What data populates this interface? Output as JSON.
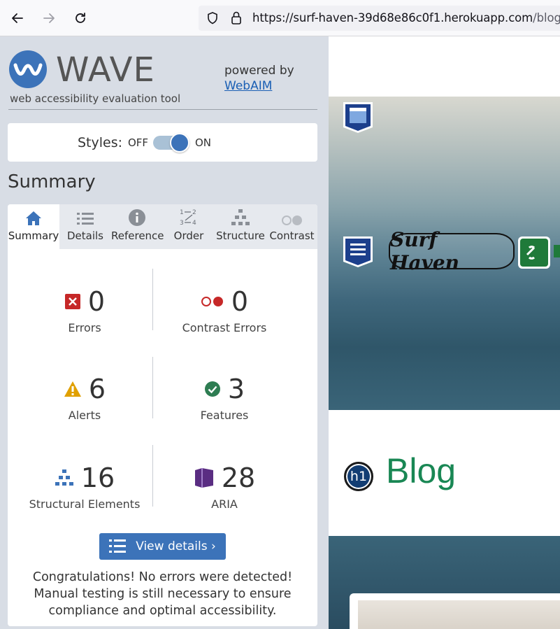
{
  "browser": {
    "url_host": "https://surf-haven-39d68e86c0f1.herokuapp.com",
    "url_path": "/blog/"
  },
  "wave": {
    "title": "WAVE",
    "tagline": "web accessibility evaluation tool",
    "powered_by": "powered by",
    "webaim_link": "WebAIM",
    "styles_label": "Styles:",
    "styles_off": "OFF",
    "styles_on": "ON",
    "styles_enabled": true,
    "summary_heading": "Summary",
    "tabs": [
      {
        "label": "Summary",
        "icon": "home-icon",
        "active": true
      },
      {
        "label": "Details",
        "icon": "list-icon",
        "active": false
      },
      {
        "label": "Reference",
        "icon": "info-icon",
        "active": false
      },
      {
        "label": "Order",
        "icon": "order-icon",
        "active": false
      },
      {
        "label": "Structure",
        "icon": "structure-icon",
        "active": false
      },
      {
        "label": "Contrast",
        "icon": "contrast-icon",
        "active": false
      }
    ],
    "stats": {
      "errors": {
        "count": "0",
        "label": "Errors"
      },
      "contrast_errors": {
        "count": "0",
        "label": "Contrast Errors"
      },
      "alerts": {
        "count": "6",
        "label": "Alerts"
      },
      "features": {
        "count": "3",
        "label": "Features"
      },
      "structural": {
        "count": "16",
        "label": "Structural Elements"
      },
      "aria": {
        "count": "28",
        "label": "ARIA"
      }
    },
    "view_details": "View details ›",
    "congrats": "Congratulations! No errors were detected! Manual testing is still necessary to ensure compliance and optimal accessibility.",
    "colors": {
      "accent": "#3c73b9",
      "error": "#c62828",
      "alert": "#e0a000",
      "feature": "#2e7d52",
      "structure": "#3c73b9",
      "aria": "#5a2d82"
    }
  },
  "page": {
    "logo_text": "Surf Haven",
    "blog_heading": "Blog",
    "h1_badge": "h1"
  }
}
